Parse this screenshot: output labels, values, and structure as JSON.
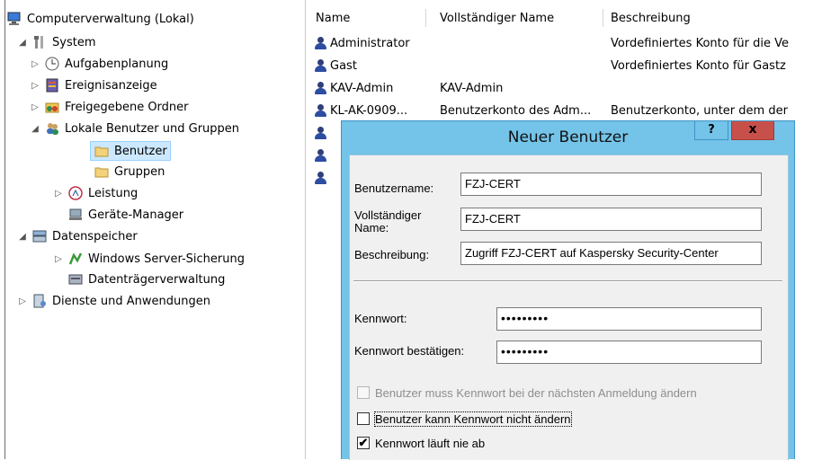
{
  "tree": {
    "root": "Computerverwaltung (Lokal)",
    "system": "System",
    "aufgabenplanung": "Aufgabenplanung",
    "ereignisanzeige": "Ereignisanzeige",
    "freigegebene_ordner": "Freigegebene Ordner",
    "lokale_benutzer": "Lokale Benutzer und Gruppen",
    "benutzer": "Benutzer",
    "gruppen": "Gruppen",
    "leistung": "Leistung",
    "geraete_manager": "Geräte-Manager",
    "datenspeicher": "Datenspeicher",
    "windows_server_sicherung": "Windows Server-Sicherung",
    "datentraegerverwaltung": "Datenträgerverwaltung",
    "dienste": "Dienste und Anwendungen"
  },
  "list": {
    "headers": [
      "Name",
      "Vollständiger Name",
      "Beschreibung"
    ],
    "rows": [
      {
        "name": "Administrator",
        "fullname": "",
        "desc": "Vordefiniertes Konto für die Ve"
      },
      {
        "name": "Gast",
        "fullname": "",
        "desc": "Vordefiniertes Konto für Gastz"
      },
      {
        "name": "KAV-Admin",
        "fullname": "KAV-Admin",
        "desc": ""
      },
      {
        "name": "KL-AK-0909...",
        "fullname": "Benutzerkonto des Adm...",
        "desc": "Benutzerkonto, unter dem der"
      }
    ]
  },
  "dialog": {
    "title": "Neuer Benutzer",
    "help": "?",
    "close": "x",
    "username_label": "Benutzername:",
    "username_value": "FZJ-CERT",
    "fullname_label": "Vollständiger Name:",
    "fullname_value": "FZJ-CERT",
    "description_label": "Beschreibung:",
    "description_value": "Zugriff FZJ-CERT auf Kaspersky Security-Center",
    "password_label": "Kennwort:",
    "password_value": "•••••••••",
    "confirm_label": "Kennwort bestätigen:",
    "confirm_value": "•••••••••",
    "check_must_change": "Benutzer muss Kennwort bei der nächsten Anmeldung ändern",
    "check_cannot_change": "Benutzer kann Kennwort nicht ändern",
    "check_never_expires": "Kennwort läuft nie ab",
    "check_never_expires_mark": "✔"
  }
}
